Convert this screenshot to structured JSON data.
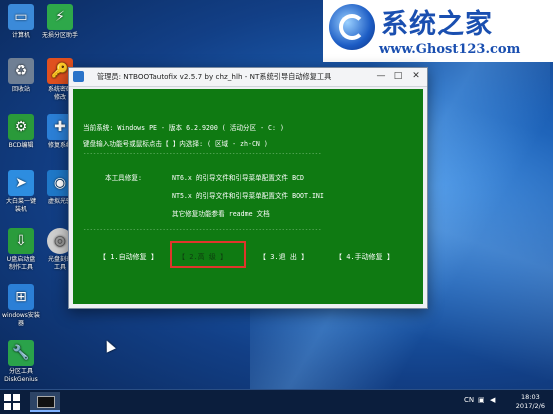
{
  "desktop": {
    "icons": [
      {
        "label": "计算机",
        "glyph": "computer-icon",
        "color": "#3b8ad9"
      },
      {
        "label": "无损分区助手",
        "glyph": "partition-assistant-icon",
        "color": "#2ea84a"
      },
      {
        "label": "回收站",
        "glyph": "recycle-bin-icon",
        "color": "#6f7f94"
      },
      {
        "label": "系统密码\n修改",
        "glyph": "password-tool-icon",
        "color": "#e0501f"
      },
      {
        "label": "BCD编辑",
        "glyph": "bcd-edit-icon",
        "color": "#2a9a3a"
      },
      {
        "label": "修复系统",
        "glyph": "repair-icon",
        "color": "#2b7fd6"
      },
      {
        "label": "大白菜一键\n装机",
        "glyph": "bird-icon",
        "color": "#2d8de0"
      },
      {
        "label": "虚拟光驱",
        "glyph": "virtual-drive-icon",
        "color": "#1f78c8"
      },
      {
        "label": "U盘启动盘\n制作工具",
        "glyph": "usb-tool-icon",
        "color": "#2a9c3c"
      },
      {
        "label": "光盘刻录\n工具",
        "glyph": "disc-icon",
        "color": "#cfcfcf"
      },
      {
        "label": "windows安装\n器",
        "glyph": "windows-installer-icon",
        "color": "#2b7fd6"
      },
      {
        "label": "分区工具\nDiskGenius",
        "glyph": "diskgenius-icon",
        "color": "#2aa24a"
      }
    ]
  },
  "watermark": {
    "title": "系统之家",
    "url": "www.Ghost123.com"
  },
  "window": {
    "title": "管理员: NTBOOTautofix v2.5.7 by chz_hlh - NT系统引导自动修复工具",
    "minimize": "—",
    "maximize": "□",
    "close": "✕",
    "console": {
      "system_line": "当前系统: Windows PE - 版本 6.2.9200  ( 活动分区 - C: )",
      "prompt_line": "键盘输入功能号或鼠标点击【 】内选择:              ( 区域 - zh-CN )",
      "divider": "------------------------------------------------------------------------",
      "repair_label": "本工具修复:",
      "repair_nt6": "NT6.x 的引导文件和引导菜单配置文件 BCD",
      "repair_nt5": "NT5.x 的引导文件和引导菜单配置文件 BOOT.INI",
      "readme_line": "其它修复功能参看 readme 文档",
      "menu": [
        {
          "label": "【 1.自动修复 】"
        },
        {
          "label": "【 2.高   级 】",
          "selected": true
        },
        {
          "label": "【 3.退   出 】"
        },
        {
          "label": "【 4.手动修复 】"
        }
      ]
    }
  },
  "taskbar": {
    "tray_lang": "CN",
    "time": "18:03",
    "date": "2017/2/6"
  },
  "colors": {
    "console_bg": "#0f7a12",
    "selection_border": "#e0352b",
    "brand_blue": "#1a4fb0"
  }
}
